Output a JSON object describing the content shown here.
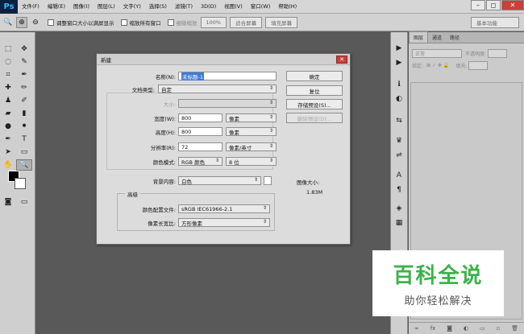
{
  "app": {
    "logo": "Ps"
  },
  "menu": [
    "文件(F)",
    "编辑(E)",
    "图像(I)",
    "图层(L)",
    "文字(Y)",
    "选择(S)",
    "滤镜(T)",
    "3D(D)",
    "视图(V)",
    "窗口(W)",
    "帮助(H)"
  ],
  "window_controls": {
    "minimize": "–",
    "restore": "◻",
    "close": "✕"
  },
  "options_bar": {
    "resize_windows": "调整窗口大小以满屏显示",
    "zoom_all": "缩放所有窗口",
    "scrubby_zoom": "细微缩放",
    "zoom_value": "100%",
    "fit_screen": "适合屏幕",
    "fill_screen": "填充屏幕",
    "workspace": "基本功能"
  },
  "panel": {
    "tabs": [
      "图层",
      "通道",
      "路径"
    ],
    "kind": "正常",
    "opacity_label": "不透明度:",
    "lock_label": "锁定:",
    "fill_label": "填充:"
  },
  "dialog": {
    "title": "新建",
    "close": "✕",
    "name_label": "名称(N):",
    "name_value": "未标题-1",
    "preset_label": "文档类型:",
    "preset_value": "自定",
    "size_label": "大小:",
    "width_label": "宽度(W):",
    "width_value": "800",
    "width_unit": "像素",
    "height_label": "高度(H):",
    "height_value": "800",
    "height_unit": "像素",
    "resolution_label": "分辨率(R):",
    "resolution_value": "72",
    "resolution_unit": "像素/英寸",
    "color_mode_label": "颜色模式:",
    "color_mode_value": "RGB 颜色",
    "bit_depth": "8 位",
    "bg_label": "背景内容:",
    "bg_value": "白色",
    "advanced": "高级",
    "profile_label": "颜色配置文件:",
    "profile_value": "sRGB IEC61966-2.1",
    "pixel_aspect_label": "像素长宽比:",
    "pixel_aspect_value": "方形像素",
    "ok": "确定",
    "reset": "复位",
    "save_preset": "存储预设(S)...",
    "delete_preset": "删除预设(D)...",
    "image_size_label": "图像大小:",
    "image_size_value": "1.83M"
  },
  "watermark": {
    "main": "百科全说",
    "sub": "助你轻松解决"
  }
}
